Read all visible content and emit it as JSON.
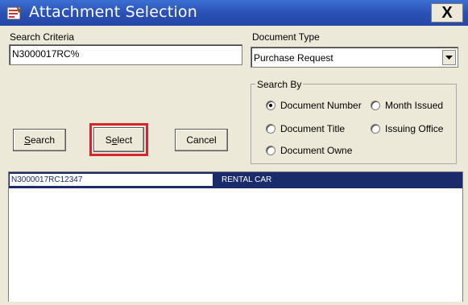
{
  "window": {
    "title": "Attachment Selection",
    "close_label": "X"
  },
  "search_criteria": {
    "label": "Search Criteria",
    "value": "N3000017RC%"
  },
  "document_type": {
    "label": "Document Type",
    "selected": "Purchase Request"
  },
  "search_by": {
    "legend": "Search By",
    "options": [
      {
        "label": "Document Number",
        "checked": true
      },
      {
        "label": "Month Issued",
        "checked": false
      },
      {
        "label": "Document Title",
        "checked": false
      },
      {
        "label": "Issuing Office",
        "checked": false
      },
      {
        "label": "Document Owne",
        "checked": false
      }
    ]
  },
  "buttons": {
    "search_prefix": "S",
    "search_rest": "earch",
    "select_pre": "S",
    "select_u": "e",
    "select_rest": "lect",
    "cancel": "Cancel"
  },
  "results": {
    "rows": [
      {
        "number": "N3000017RC12347",
        "title": "RENTAL CAR",
        "selected": true
      }
    ]
  },
  "colors": {
    "titlebar": "#2a4fb4",
    "selection": "#1b2a6b",
    "highlight": "#d8242a"
  }
}
